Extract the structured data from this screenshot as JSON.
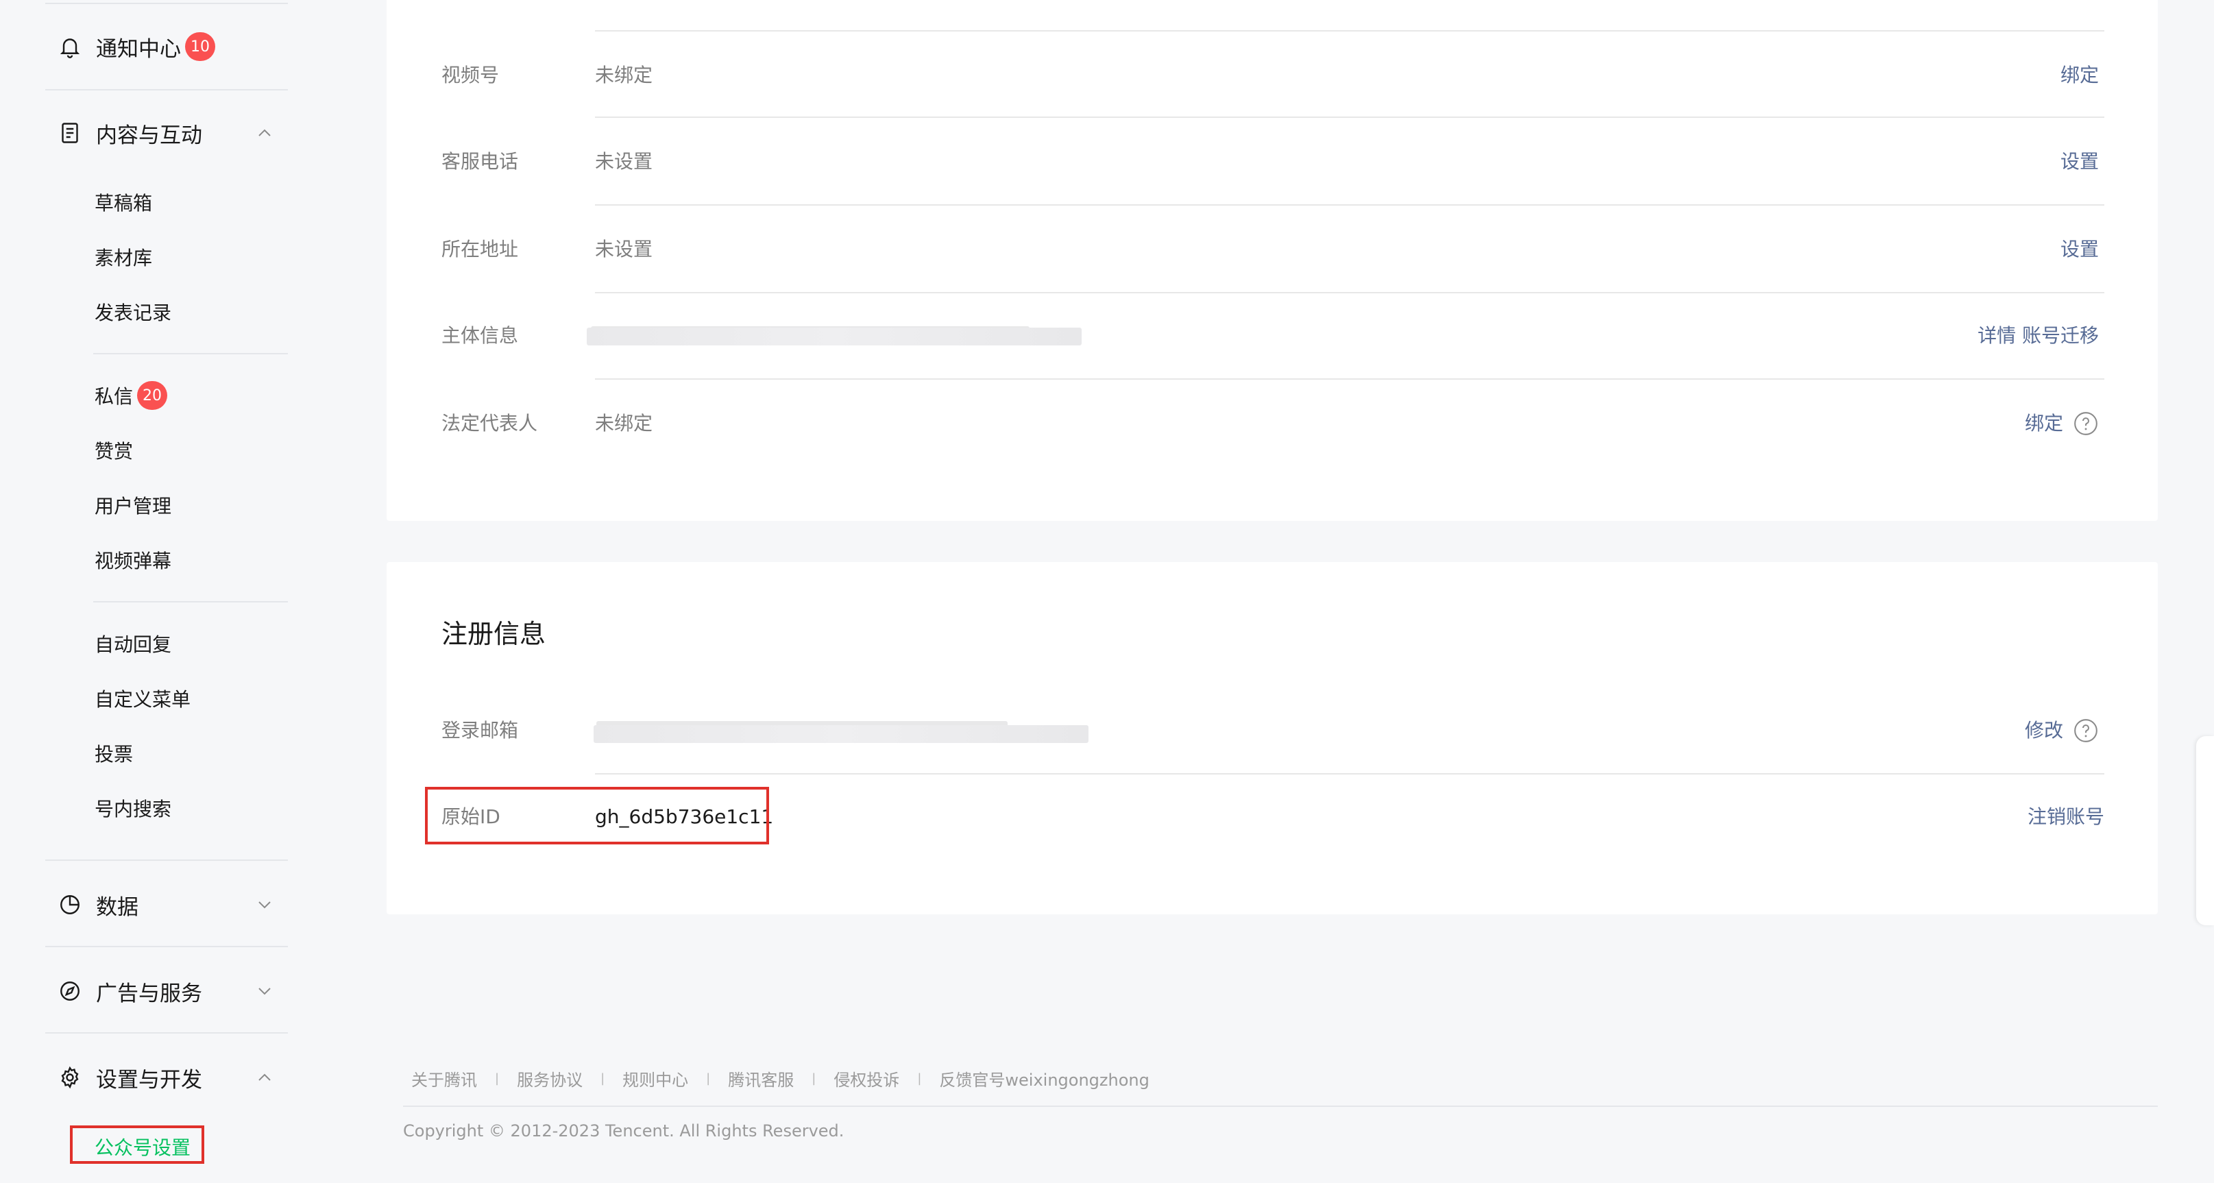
{
  "sidebar": {
    "notifications": {
      "label": "通知中心",
      "badge": "10"
    },
    "content": {
      "label": "内容与互动",
      "items": [
        "草稿箱",
        "素材库",
        "发表记录"
      ],
      "items2": [
        {
          "label": "私信",
          "badge": "20"
        },
        {
          "label": "赞赏"
        },
        {
          "label": "用户管理"
        },
        {
          "label": "视频弹幕"
        }
      ],
      "items3": [
        "自动回复",
        "自定义菜单",
        "投票",
        "号内搜索"
      ]
    },
    "data_label": "数据",
    "ads_label": "广告与服务",
    "settings": {
      "label": "设置与开发",
      "active_item": "公众号设置"
    }
  },
  "account_info": {
    "rows": [
      {
        "label": "视频号",
        "value": "未绑定",
        "action": "绑定"
      },
      {
        "label": "客服电话",
        "value": "未设置",
        "action": "设置"
      },
      {
        "label": "所在地址",
        "value": "未设置",
        "action": "设置"
      },
      {
        "label": "主体信息",
        "value": "",
        "action": "详情 账号迁移"
      },
      {
        "label": "法定代表人",
        "value": "未绑定",
        "action": "绑定"
      }
    ]
  },
  "registration": {
    "title": "注册信息",
    "email": {
      "label": "登录邮箱",
      "action": "修改"
    },
    "original_id": {
      "label": "原始ID",
      "value": "gh_6d5b736e1c11",
      "action": "注销账号"
    }
  },
  "footer": {
    "links": [
      "关于腾讯",
      "服务协议",
      "规则中心",
      "腾讯客服",
      "侵权投诉",
      "反馈官号weixingongzhong"
    ],
    "separator": "|",
    "copyright": "Copyright © 2012-2023 Tencent. All Rights Reserved."
  },
  "colors": {
    "link": "#576b95",
    "badge": "#fa5151",
    "active": "#07c160",
    "highlight": "#e0312b"
  }
}
